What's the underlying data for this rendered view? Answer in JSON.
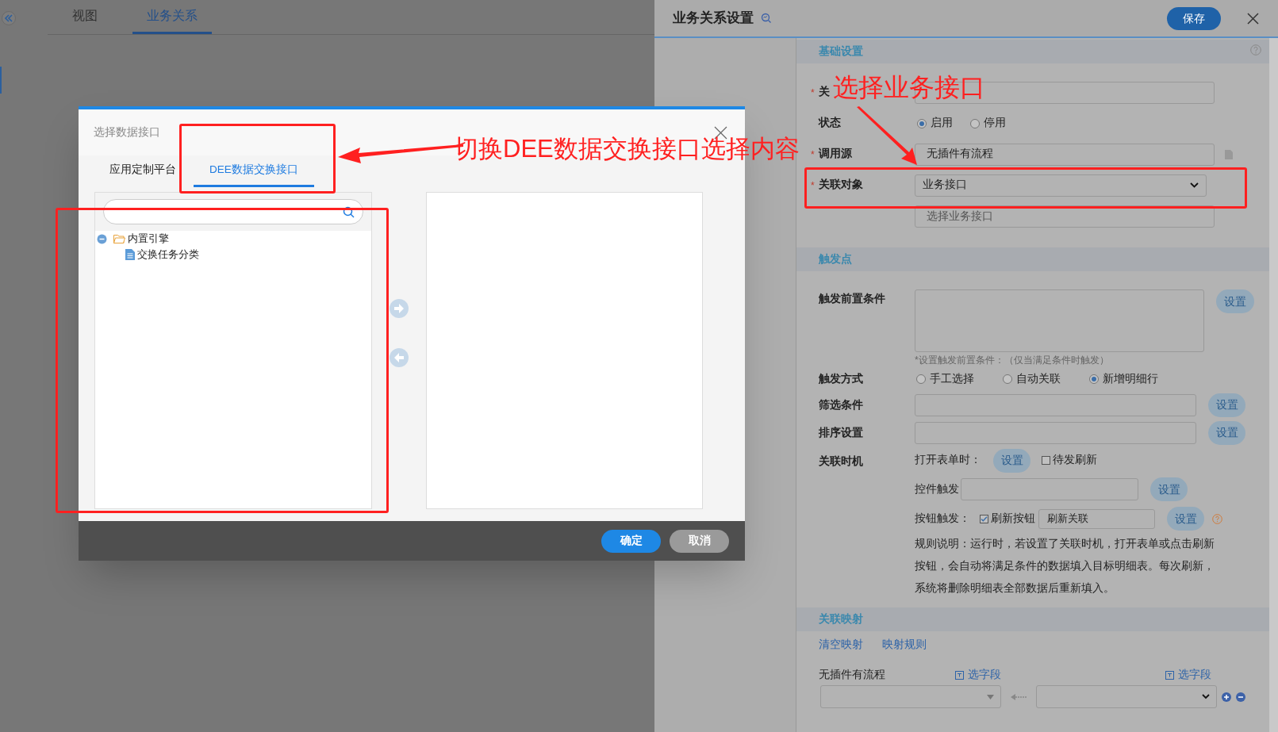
{
  "top_tabs": [
    {
      "label": "视图",
      "selected": false
    },
    {
      "label": "业务关系",
      "selected": true
    }
  ],
  "settings": {
    "title": "业务关系设置",
    "save_button": "保存",
    "basic": {
      "heading": "基础设置",
      "name": {
        "label": "关",
        "marker": "*"
      },
      "status": {
        "label": "状态",
        "options": [
          {
            "label": "启用",
            "selected": true
          },
          {
            "label": "停用",
            "selected": false
          }
        ]
      },
      "source": {
        "label": "调用源",
        "marker": "*",
        "value": "无插件有流程"
      },
      "target": {
        "label": "关联对象",
        "marker": "*",
        "value": "业务接口"
      },
      "interface": {
        "placeholder": "选择业务接口"
      }
    },
    "trigger": {
      "heading": "触发点",
      "precondition": {
        "label": "触发前置条件",
        "button": "设置",
        "hint": "*设置触发前置条件：（仅当满足条件时触发）"
      },
      "mode": {
        "label": "触发方式",
        "options": [
          {
            "label": "手工选择",
            "selected": false
          },
          {
            "label": "自动关联",
            "selected": false
          },
          {
            "label": "新增明细行",
            "selected": true
          }
        ]
      },
      "filter": {
        "label": "筛选条件",
        "button": "设置"
      },
      "sort": {
        "label": "排序设置",
        "button": "设置"
      },
      "timing": {
        "label": "关联时机",
        "on_open": {
          "label": "打开表单时：",
          "button": "设置",
          "checkbox": {
            "label": "待发刷新",
            "checked": false
          }
        },
        "control": {
          "label": "控件触发",
          "button": "设置"
        },
        "button_trigger": {
          "label": "按钮触发：",
          "checkbox": {
            "label": "刷新按钮",
            "checked": true
          },
          "value": "刷新关联",
          "button": "设置"
        },
        "rule": "规则说明：运行时，若设置了关联时机，打开表单或点击刷新按钮，会自动将满足条件的数据填入目标明细表。每次刷新，系统将删除明细表全部数据后重新填入。"
      }
    },
    "mapping": {
      "heading": "关联映射",
      "links": [
        "清空映射",
        "映射规则"
      ],
      "source_label": "无插件有流程",
      "pick_fields": [
        "选字段",
        "选字段"
      ]
    }
  },
  "dialog": {
    "title": "选择数据接口",
    "tabs": [
      {
        "label": "应用定制平台",
        "selected": false
      },
      {
        "label": "DEE数据交换接口",
        "selected": true
      }
    ],
    "tree": [
      {
        "label": "内置引擎",
        "expanded": true,
        "children": [
          {
            "label": "交换任务分类"
          }
        ]
      }
    ],
    "buttons": [
      {
        "label": "确定",
        "kind": "primary"
      },
      {
        "label": "取消",
        "kind": "secondary"
      }
    ]
  },
  "annotations": [
    {
      "text": "切换DEE数据交换接口选择内容"
    },
    {
      "text": "选择业务接口"
    }
  ]
}
